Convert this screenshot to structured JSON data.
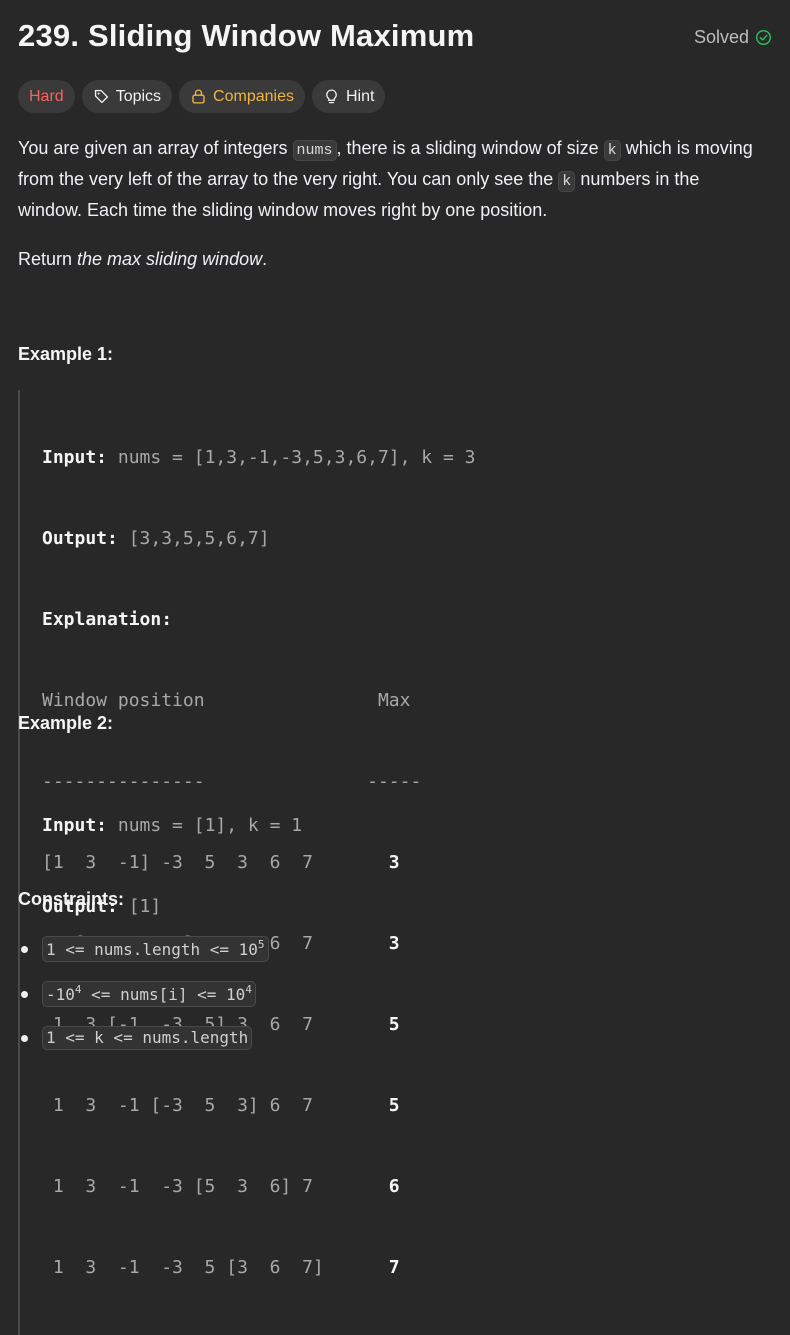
{
  "problem": {
    "title": "239. Sliding Window Maximum",
    "status": "Solved",
    "chips": {
      "difficulty": "Hard",
      "topics": "Topics",
      "companies": "Companies",
      "hint": "Hint"
    }
  },
  "description": {
    "p1_a": "You are given an array of integers ",
    "p1_code1": "nums",
    "p1_b": ", there is a sliding window of size ",
    "p1_code2": "k",
    "p1_c": " which is moving from the very left of the array to the very right. You can only see the ",
    "p1_code3": "k",
    "p1_d": " numbers in the window. Each time the sliding window moves right by one position.",
    "p2_a": "Return ",
    "p2_em": "the max sliding window",
    "p2_b": "."
  },
  "example1": {
    "heading": "Example 1:",
    "input_label": "Input:",
    "input_value": " nums = [1,3,-1,-3,5,3,6,7], k = 3",
    "output_label": "Output:",
    "output_value": " [3,3,5,5,6,7]",
    "explanation_label": "Explanation:",
    "header": "Window position                Max",
    "divider": "---------------               -----",
    "rows": [
      {
        "window": "[1  3  -1] -3  5  3  6  7       ",
        "max": "3"
      },
      {
        "window": " 1 [3  -1  -3] 5  3  6  7       ",
        "max": "3"
      },
      {
        "window": " 1  3 [-1  -3  5] 3  6  7       ",
        "max": "5"
      },
      {
        "window": " 1  3  -1 [-3  5  3] 6  7       ",
        "max": "5"
      },
      {
        "window": " 1  3  -1  -3 [5  3  6] 7       ",
        "max": "6"
      },
      {
        "window": " 1  3  -1  -3  5 [3  6  7]      ",
        "max": "7"
      }
    ]
  },
  "example2": {
    "heading": "Example 2:",
    "input_label": "Input:",
    "input_value": " nums = [1], k = 1",
    "output_label": "Output:",
    "output_value": " [1]"
  },
  "constraints": {
    "heading": "Constraints:",
    "c1_text": "1 <= nums.length <= 10",
    "c1_sup": "5",
    "c2_a": "-10",
    "c2_sup1": "4",
    "c2_b": " <= nums[i] <= 10",
    "c2_sup2": "4",
    "c3_text": "1 <= k <= nums.length"
  },
  "colors": {
    "background": "#282828",
    "hard": "#f8615c",
    "companies": "#f0b541",
    "solved_check": "#2cbb5d"
  }
}
